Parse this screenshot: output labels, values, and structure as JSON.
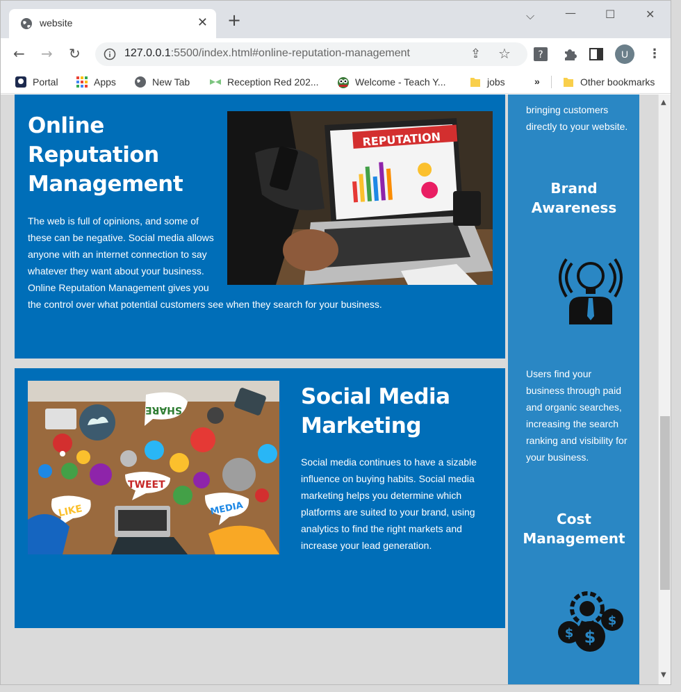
{
  "tab": {
    "title": "website"
  },
  "toolbar": {
    "url_host": "127.0.0.1",
    "url_rest": ":5500/index.html#online-reputation-management",
    "avatar_letter": "U"
  },
  "bookmarks": {
    "items": [
      {
        "label": "Portal"
      },
      {
        "label": "Apps"
      },
      {
        "label": "New Tab"
      },
      {
        "label": "Reception Red 202..."
      },
      {
        "label": "Welcome - Teach Y..."
      },
      {
        "label": "jobs"
      }
    ],
    "overflow": "»",
    "other": "Other bookmarks"
  },
  "orm": {
    "title_line1": "Online",
    "title_line2": "Reputation",
    "title_line3": "Management",
    "body": "The web is full of opinions, and some of these can be negative. Social media allows anyone with an internet connection to say whatever they want about your business. Online Reputation Management gives you the control over what potential customers see when they search for your business.",
    "image_banner": "REPUTATION"
  },
  "smm": {
    "title_line1": "Social Media",
    "title_line2": "Marketing",
    "body": "Social media continues to have a sizable influence on buying habits. Social media marketing helps you determine which platforms are suited to your brand, using analytics to find the right markets and increase your lead generation.",
    "bubble_share": "SHARE",
    "bubble_tweet": "TWEET",
    "bubble_like": "LIKE",
    "bubble_media": "MEDIA"
  },
  "sidebar": {
    "intro_tail": "bringing customers directly to your website.",
    "brand_title_1": "Brand",
    "brand_title_2": "Awareness",
    "brand_body": "Users find your business through paid and organic searches, increasing the search ranking and visibility for your business.",
    "cost_title_1": "Cost",
    "cost_title_2": "Management"
  },
  "colors": {
    "card_blue": "#006eb8",
    "sidebar_blue": "#2a87c4",
    "page_gray": "#dadada"
  }
}
